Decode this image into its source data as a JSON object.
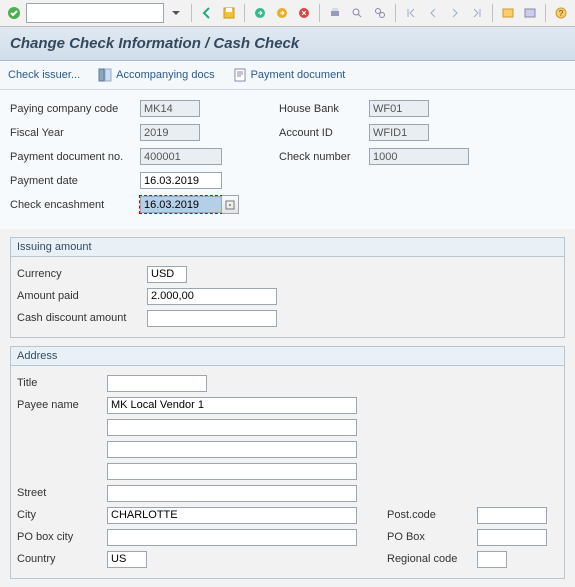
{
  "title": "Change Check Information / Cash Check",
  "menubar": {
    "issuer": "Check issuer...",
    "docs": "Accompanying docs",
    "payment": "Payment document"
  },
  "left_labels": {
    "company": "Paying company code",
    "fiscal": "Fiscal Year",
    "pdoc": "Payment document no.",
    "pdate": "Payment date",
    "encash": "Check encashment"
  },
  "left_values": {
    "company": "MK14",
    "fiscal": "2019",
    "pdoc": "400001",
    "pdate": "16.03.2019",
    "encash": "16.03.2019"
  },
  "right_labels": {
    "house": "House Bank",
    "acct": "Account ID",
    "cnum": "Check number"
  },
  "right_values": {
    "house": "WF01",
    "acct": "WFID1",
    "cnum": "1000"
  },
  "issuing": {
    "title": "Issuing amount",
    "labels": {
      "cur": "Currency",
      "amt": "Amount paid",
      "disc": "Cash discount amount"
    },
    "values": {
      "cur": "USD",
      "amt": "2.000,00",
      "disc": ""
    }
  },
  "address": {
    "title": "Address",
    "labels": {
      "title": "Title",
      "payee": "Payee name",
      "street": "Street",
      "city": "City",
      "pobcity": "PO box city",
      "country": "Country",
      "post": "Post.code",
      "pobox": "PO Box",
      "region": "Regional code"
    },
    "values": {
      "title": "",
      "payee": "MK Local Vendor 1",
      "l2": "",
      "l3": "",
      "l4": "",
      "street": "",
      "city": "CHARLOTTE",
      "pobcity": "",
      "country": "US",
      "post": "",
      "pobox": "",
      "region": ""
    }
  }
}
